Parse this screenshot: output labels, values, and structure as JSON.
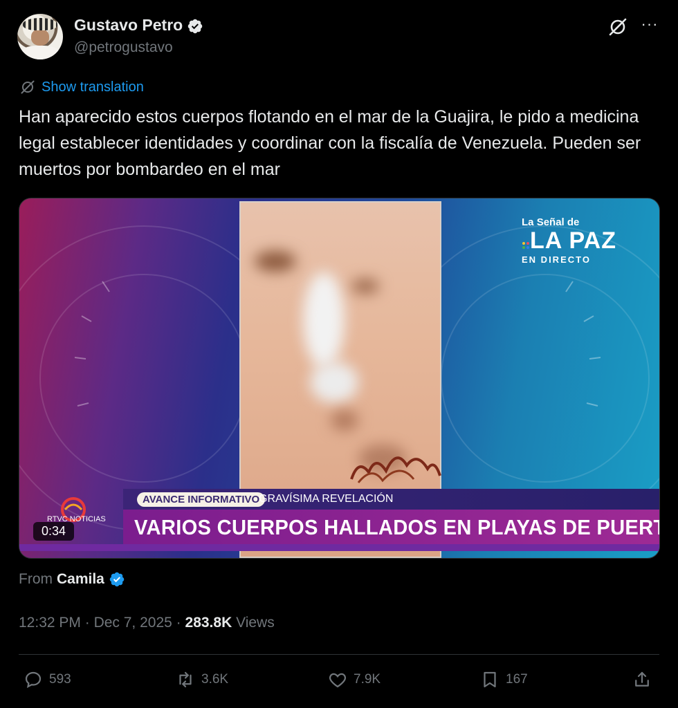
{
  "author": {
    "name": "Gustavo Petro",
    "handle": "@petrogustavo"
  },
  "header": {
    "more_label": "···"
  },
  "translation": {
    "link_label": "Show translation"
  },
  "tweet": {
    "text": "Han aparecido estos cuerpos flotando en el mar de la Guajira, le pido a medicina legal establecer identidades y coordinar con la fiscalía de Venezuela. Pueden ser muertos por bombardeo en el mar"
  },
  "video": {
    "brand_sub": "La Señal de",
    "brand_big": "LA PAZ",
    "brand_live": "EN DIRECTO",
    "tag_advance": "AVANCE INFORMATIVO",
    "tag_secondary": "GRAVÍSIMA REVELACIÓN",
    "headline": "VARIOS CUERPOS HALLADOS EN PLAYAS DE PUERTO LÓPEZ",
    "channel": "RTVC NOTICIAS",
    "duration": "0:34"
  },
  "from": {
    "prefix": "From",
    "name": "Camila"
  },
  "meta": {
    "time": "12:32 PM",
    "sep1": "·",
    "date": "Dec 7, 2025",
    "sep2": "·",
    "views_count": "283.8K",
    "views_label": "Views"
  },
  "actions": {
    "replies": "593",
    "reposts": "3.6K",
    "likes": "7.9K",
    "bookmarks": "167"
  },
  "colors": {
    "accent": "#1d9bf0",
    "muted": "#71767b",
    "text": "#e7e9ea",
    "background": "#000000"
  }
}
